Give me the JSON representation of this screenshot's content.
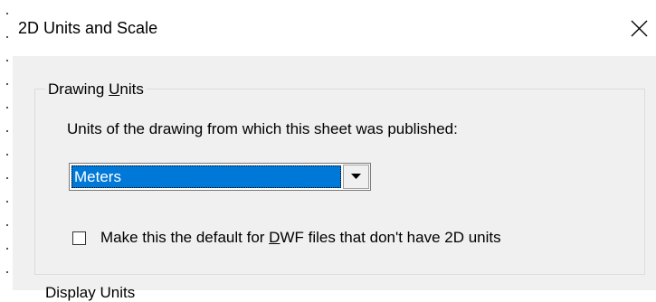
{
  "window": {
    "title": "2D Units and Scale",
    "close_icon": "close-icon"
  },
  "drawing_units": {
    "legend_prefix": "Drawing ",
    "legend_underlined": "U",
    "legend_suffix": "nits",
    "description": "Units of the drawing from which this sheet was published:",
    "units_select": {
      "selected": "Meters",
      "arrow_icon": "chevron-down-icon"
    },
    "default_checkbox": {
      "label_prefix": "Make this the default for ",
      "label_underlined": "D",
      "label_suffix": "WF files that don't have 2D units",
      "checked": false
    }
  },
  "display_units": {
    "legend": "Display Units"
  },
  "colors": {
    "dialog_bg": "#f0f0f0",
    "titlebar_bg": "#ffffff",
    "selection": "#0078d7"
  }
}
